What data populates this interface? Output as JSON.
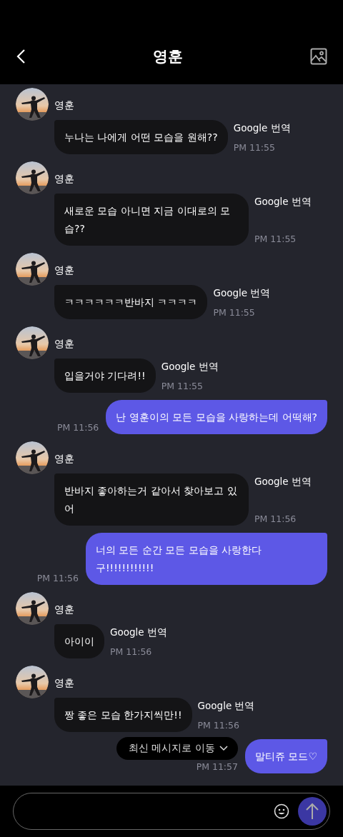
{
  "header": {
    "title": "영훈"
  },
  "messages": [
    {
      "kind": "incoming",
      "name": "영훈",
      "text": "누나는 나에게 어떤 모습을 원해??",
      "translate": "Google 번역",
      "time": "PM 11:55"
    },
    {
      "kind": "incoming",
      "name": "영훈",
      "text": "새로운 모습 아니면 지금 이대로의 모습??",
      "translate": "Google 번역",
      "time": "PM 11:55"
    },
    {
      "kind": "incoming",
      "name": "영훈",
      "text": "ㅋㅋㅋㅋㅋㅋ반바지 ㅋㅋㅋㅋ",
      "translate": "Google 번역",
      "time": "PM 11:55"
    },
    {
      "kind": "incoming",
      "name": "영훈",
      "text": "입을거야 기다려!!",
      "translate": "Google 번역",
      "time": "PM 11:55"
    },
    {
      "kind": "outgoing",
      "text": "난 영훈이의 모든 모습을 사랑하는데 어떡해?",
      "time": "PM 11:56"
    },
    {
      "kind": "incoming",
      "name": "영훈",
      "text": "반바지 좋아하는거 같아서 찾아보고 있어",
      "translate": "Google 번역",
      "time": "PM 11:56"
    },
    {
      "kind": "outgoing",
      "text": "너의 모든 순간 모든 모습을 사랑한다 구!!!!!!!!!!!!",
      "time": "PM 11:56"
    },
    {
      "kind": "incoming",
      "name": "영훈",
      "text": "아이이",
      "translate": "Google 번역",
      "time": "PM 11:56"
    },
    {
      "kind": "incoming",
      "name": "영훈",
      "text": "짱 좋은 모습 한가지씩만!!",
      "translate": "Google 번역",
      "time": "PM 11:56"
    },
    {
      "kind": "outgoing",
      "text": "말티쥬 모드♡",
      "time": "PM 11:57"
    }
  ],
  "jump_button": {
    "label": "최신 메시지로 이동"
  }
}
